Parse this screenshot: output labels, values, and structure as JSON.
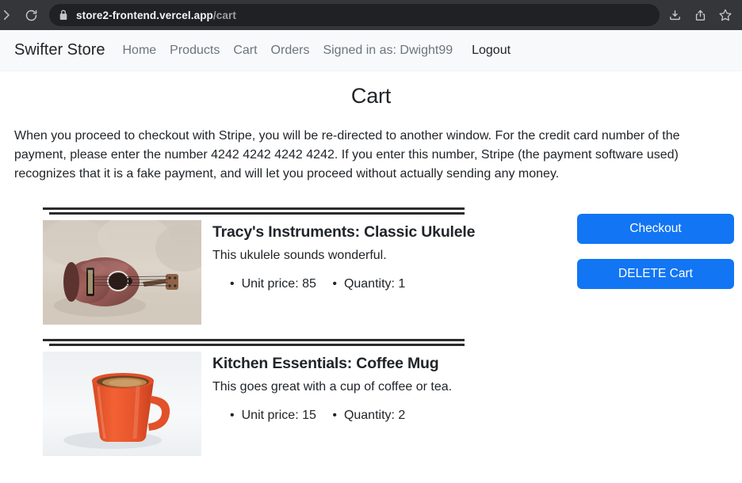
{
  "browser": {
    "url_host": "store2-frontend.vercel.app",
    "url_path": "/cart",
    "icons": {
      "forward": "forward-arrow-icon",
      "reload": "reload-icon",
      "lock": "lock-icon",
      "install": "install-app-icon",
      "share": "share-icon",
      "bookmark": "star-bookmark-icon"
    }
  },
  "navbar": {
    "brand": "Swifter Store",
    "links": [
      {
        "label": "Home"
      },
      {
        "label": "Products"
      },
      {
        "label": "Cart"
      },
      {
        "label": "Orders"
      }
    ],
    "signed_in_as": "Signed in as: Dwight99",
    "logout": "Logout"
  },
  "page": {
    "title": "Cart",
    "intro": "When you proceed to checkout with Stripe, you will be re-directed to another window. For the credit card number of the payment, please enter the number 4242 4242 4242 4242. If you enter this number, Stripe (the payment software used) recognizes that it is a fake payment, and will let you proceed without actually sending any money."
  },
  "cart": {
    "items": [
      {
        "title": "Tracy's Instruments: Classic Ukulele",
        "description": "This ukulele sounds wonderful.",
        "unit_price_label": "Unit price: 85",
        "quantity_label": "Quantity: 1",
        "image_name": "ukulele-photo"
      },
      {
        "title": "Kitchen Essentials: Coffee Mug",
        "description": "This goes great with a cup of coffee or tea.",
        "unit_price_label": "Unit price: 15",
        "quantity_label": "Quantity: 2",
        "image_name": "coffee-mug-photo"
      }
    ]
  },
  "actions": {
    "checkout": "Checkout",
    "delete_cart": "DELETE Cart"
  },
  "colors": {
    "button_blue": "#1275f4",
    "chrome_bar": "#35363a",
    "url_pill": "#202124",
    "navbar_bg": "#f8f9fa",
    "text": "#212529",
    "muted_text": "#6c757d"
  }
}
